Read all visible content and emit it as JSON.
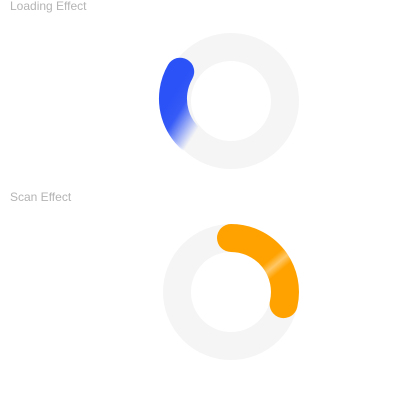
{
  "loading_effect": {
    "label": "Loading Effect",
    "accent_color": "#2b52f7",
    "track_color": "#f5f5f5"
  },
  "scan_effect": {
    "label": "Scan Effect",
    "accent_color": "#ffa200",
    "highlight_color": "#ffc766",
    "track_color": "#f5f5f5"
  }
}
